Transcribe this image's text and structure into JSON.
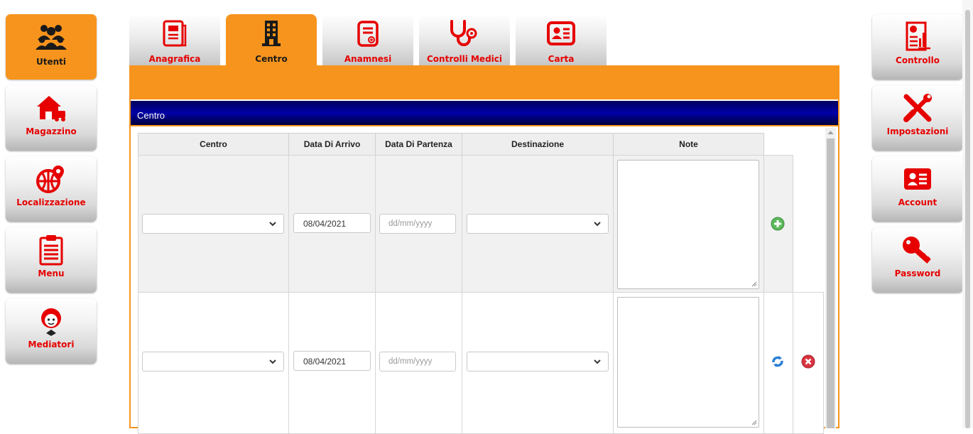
{
  "left_nav": [
    {
      "label": "Utenti",
      "icon": "users-icon",
      "active": true
    },
    {
      "label": "Magazzino",
      "icon": "warehouse-icon",
      "active": false
    },
    {
      "label": "Localizzazione",
      "icon": "globe-pin-icon",
      "active": false
    },
    {
      "label": "Menu",
      "icon": "clipboard-icon",
      "active": false
    },
    {
      "label": "Mediatori",
      "icon": "mediator-icon",
      "active": false
    }
  ],
  "right_nav": [
    {
      "label": "Controllo",
      "icon": "report-chart-icon"
    },
    {
      "label": "Impostazioni",
      "icon": "tools-icon"
    },
    {
      "label": "Account",
      "icon": "id-card-icon"
    },
    {
      "label": "Password",
      "icon": "key-icon"
    }
  ],
  "tabs": [
    {
      "label": "Anagrafica",
      "icon": "document-icon",
      "active": false
    },
    {
      "label": "Centro",
      "icon": "building-icon",
      "active": true
    },
    {
      "label": "Anamnesi",
      "icon": "medical-record-icon",
      "active": false
    },
    {
      "label": "Controlli Medici",
      "icon": "stethoscope-icon",
      "active": false
    },
    {
      "label": "Carta",
      "icon": "id-card-icon",
      "active": false
    }
  ],
  "panel": {
    "title": "Centro",
    "columns": [
      "Centro",
      "Data Di Arrivo",
      "Data Di Partenza",
      "Destinazione",
      "Note"
    ],
    "rows": [
      {
        "centro": "",
        "data_arrivo": "08/04/2021",
        "data_partenza_placeholder": "dd/mm/yyyy",
        "destinazione": "",
        "note": "",
        "actions": [
          "add"
        ]
      },
      {
        "centro": "",
        "data_arrivo": "08/04/2021",
        "data_partenza_placeholder": "dd/mm/yyyy",
        "destinazione": "",
        "note": "",
        "actions": [
          "refresh",
          "delete"
        ]
      }
    ]
  },
  "colors": {
    "accent_orange": "#f7941d",
    "label_red": "#e60000",
    "header_navy": "#00008b",
    "add_green": "#5cb85c",
    "refresh_blue": "#2a7fd4",
    "delete_red": "#d9333f"
  }
}
